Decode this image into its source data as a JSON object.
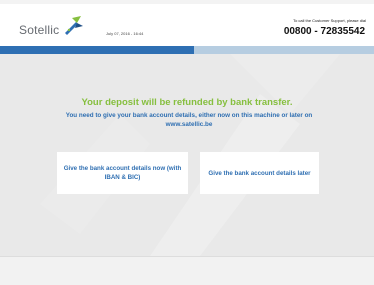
{
  "header": {
    "logo_text": "Sotellic",
    "date": "July 07, 2016 - 16:44",
    "support_text": "To call the Customer Support, please dial",
    "support_phone": "00800 - 72835542"
  },
  "main": {
    "headline": "Your deposit will be refunded by bank transfer.",
    "subtext": "You need to give your bank account details, either now on this machine or later on www.satellic.be",
    "buttons": [
      {
        "label": "Give the bank account details now (with IBAN & BIC)"
      },
      {
        "label": "Give the bank account details later"
      }
    ]
  },
  "colors": {
    "accent_blue": "#2f6fb2",
    "accent_green": "#86bf3f",
    "background": "#e9e9e9"
  },
  "icons": {
    "logo": "satellic-logo-mark"
  }
}
